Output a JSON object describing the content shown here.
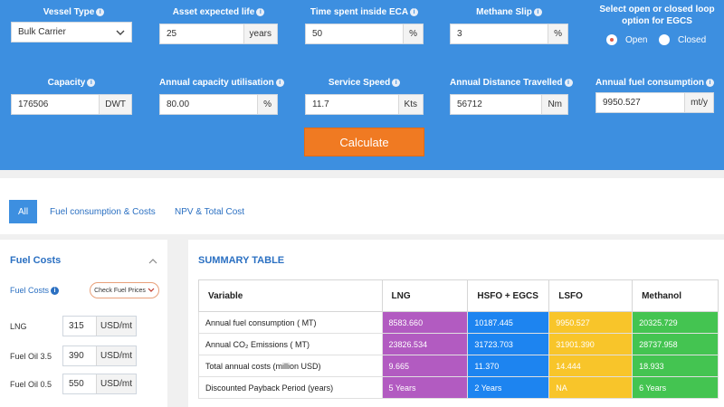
{
  "inputs": {
    "vessel_type": {
      "label": "Vessel Type",
      "value": "Bulk Carrier"
    },
    "asset_life": {
      "label": "Asset expected life",
      "value": "25",
      "unit": "years"
    },
    "time_eca": {
      "label": "Time spent inside ECA",
      "value": "50",
      "unit": "%"
    },
    "methane_slip": {
      "label": "Methane Slip",
      "value": "3",
      "unit": "%"
    },
    "capacity": {
      "label": "Capacity",
      "value": "176506",
      "unit": "DWT"
    },
    "utilisation": {
      "label": "Annual capacity utilisation",
      "value": "80.00",
      "unit": "%"
    },
    "speed": {
      "label": "Service Speed",
      "value": "11.7",
      "unit": "Kts"
    },
    "distance": {
      "label": "Annual Distance Travelled",
      "value": "56712",
      "unit": "Nm"
    },
    "fuel_consumption": {
      "label": "Annual fuel consumption",
      "value": "9950.527",
      "unit": "mt/y"
    }
  },
  "egcs": {
    "title": "Select open or closed loop option for EGCS",
    "open": "Open",
    "closed": "Closed",
    "selected": "Open"
  },
  "calculate_label": "Calculate",
  "tabs": [
    "All",
    "Fuel consumption & Costs",
    "NPV & Total Cost"
  ],
  "fuel_costs": {
    "title": "Fuel Costs",
    "label": "Fuel Costs",
    "check_button": "Check Fuel Prices",
    "rows": [
      {
        "name": "LNG",
        "value": "315",
        "unit": "USD/mt"
      },
      {
        "name": "Fuel Oil 3.5",
        "value": "390",
        "unit": "USD/mt"
      },
      {
        "name": "Fuel Oil 0.5",
        "value": "550",
        "unit": "USD/mt"
      }
    ]
  },
  "summary": {
    "title": "SUMMARY TABLE",
    "headers": [
      "Variable",
      "LNG",
      "HSFO + EGCS",
      "LSFO",
      "Methanol"
    ],
    "rows": [
      {
        "variable": "Annual fuel consumption ( MT)",
        "lng": "8583.660",
        "hsfo": "10187.445",
        "lsfo": "9950.527",
        "meth": "20325.729"
      },
      {
        "variable": "Annual CO₂ Emissions ( MT)",
        "lng": "23826.534",
        "hsfo": "31723.703",
        "lsfo": "31901.390",
        "meth": "28737.958"
      },
      {
        "variable": "Total annual costs (million USD)",
        "lng": "9.665",
        "hsfo": "11.370",
        "lsfo": "14.444",
        "meth": "18.933"
      },
      {
        "variable": "Discounted Payback Period (years)",
        "lng": "5 Years",
        "hsfo": "2 Years",
        "lsfo": "NA",
        "meth": "6 Years"
      }
    ]
  },
  "colors": {
    "header_blue": "#3d8fe0",
    "button_orange": "#f07a22",
    "lng": "#b25bc1",
    "hsfo": "#1d84f0",
    "lsfo": "#f8c52a",
    "methanol": "#44c451"
  }
}
